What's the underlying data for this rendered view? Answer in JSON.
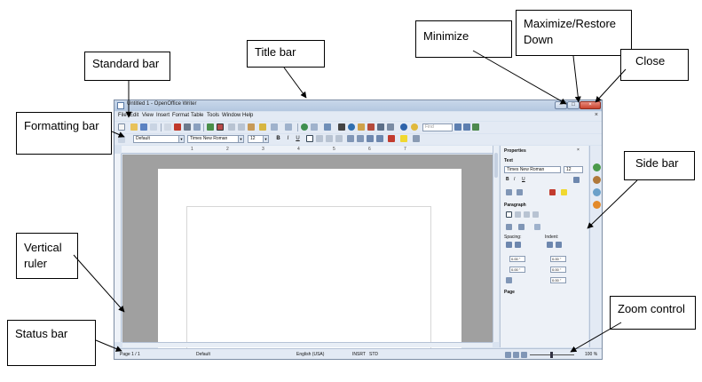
{
  "window": {
    "title": "Untitled 1 - OpenOffice Writer",
    "controls": {
      "minimize": "–",
      "maximize": "□",
      "close": "×"
    }
  },
  "menu": {
    "items": [
      "File",
      "Edit",
      "View",
      "Insert",
      "Format",
      "Table",
      "Tools",
      "Window",
      "Help"
    ],
    "doc_close": "×"
  },
  "standard_toolbar": {
    "find_placeholder": "Find"
  },
  "formatting_toolbar": {
    "style": "Default",
    "font": "Times New Roman",
    "size": "12",
    "bold": "B",
    "italic": "I",
    "underline": "U"
  },
  "ruler": {
    "ticks": [
      "1",
      "2",
      "3",
      "4",
      "5",
      "6",
      "7"
    ]
  },
  "sidebar": {
    "title": "Properties",
    "text_section": "Text",
    "font": "Times New Roman",
    "size": "12",
    "paragraph_section": "Paragraph",
    "spacing_label": "Spacing:",
    "indent_label": "Indent:",
    "spin_values": [
      "0.00 \"",
      "0.00 \"",
      "0.00 \"",
      "0.00 \"",
      "0.00 \""
    ],
    "page_section": "Page"
  },
  "status": {
    "page": "Page 1 / 1",
    "style": "Default",
    "language": "English (USA)",
    "insert": "INSRT",
    "std": "STD",
    "zoom": "100 %"
  },
  "callouts": {
    "title_bar": "Title bar",
    "standard_bar": "Standard bar",
    "formatting_bar": "Formatting bar",
    "minimize": "Minimize",
    "maximize_restore": "Maximize/Restore Down",
    "close": "Close",
    "side_bar": "Side bar",
    "vertical_ruler": "Vertical ruler",
    "status_bar": "Status bar",
    "zoom_control": "Zoom control"
  }
}
